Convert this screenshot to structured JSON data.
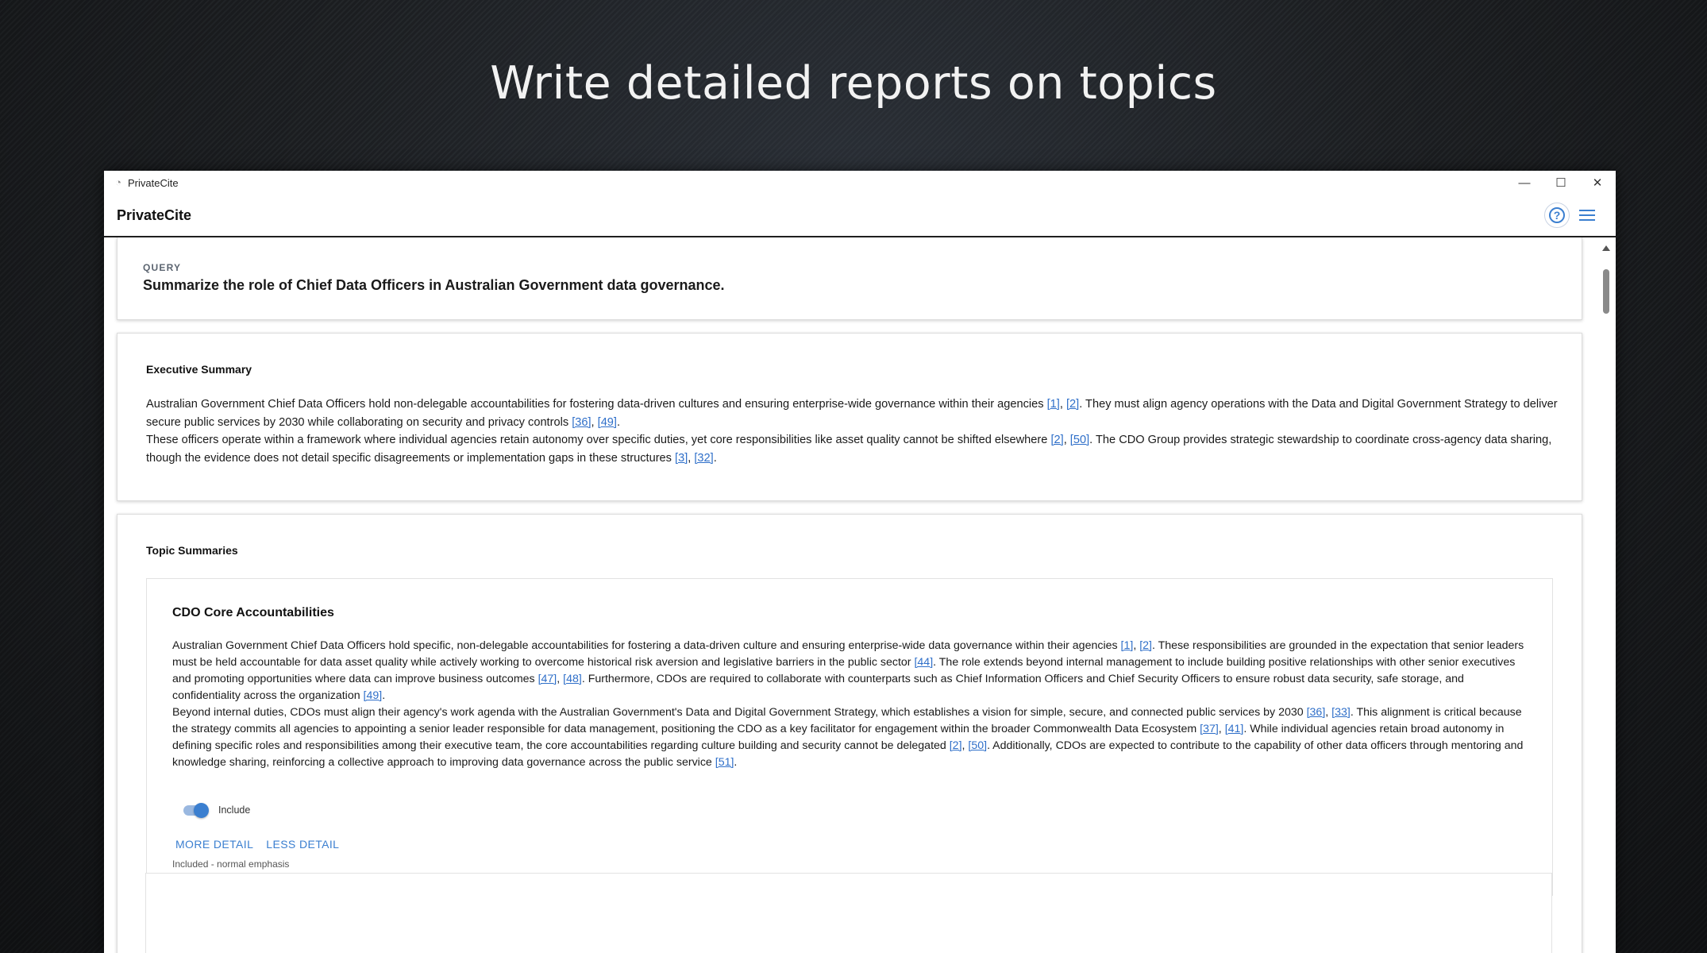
{
  "banner": {
    "title": "Write detailed reports on topics"
  },
  "window": {
    "title": "PrivateCite",
    "controls": {
      "minimize": "—",
      "maximize": "☐",
      "close": "✕"
    }
  },
  "header": {
    "brand": "PrivateCite",
    "help_icon": "?"
  },
  "query": {
    "label": "QUERY",
    "text": "Summarize the role of Chief Data Officers in Australian Government data governance."
  },
  "executive_summary": {
    "heading": "Executive Summary",
    "p1": {
      "t1": "Australian Government Chief Data Officers hold non-delegable accountabilities for fostering data-driven cultures and ensuring enterprise-wide governance within their agencies ",
      "c1": "[1]",
      "s1": ", ",
      "c2": "[2]",
      "t2": ". They must align agency operations with the Data and Digital Government Strategy to deliver secure public services by 2030 while collaborating on security and privacy controls ",
      "c3": "[36]",
      "s2": ", ",
      "c4": "[49]",
      "t3": "."
    },
    "p2": {
      "t1": "These officers operate within a framework where individual agencies retain autonomy over specific duties, yet core responsibilities like asset quality cannot be shifted elsewhere ",
      "c1": "[2]",
      "s1": ", ",
      "c2": "[50]",
      "t2": ". The CDO Group provides strategic stewardship to coordinate cross-agency data sharing, though the evidence does not detail specific disagreements or implementation gaps in these structures ",
      "c3": "[3]",
      "s2": ", ",
      "c4": "[32]",
      "t3": "."
    }
  },
  "topic_summaries": {
    "heading": "Topic Summaries",
    "topics": [
      {
        "title": "CDO Core Accountabilities",
        "p1": {
          "t1": "Australian Government Chief Data Officers hold specific, non-delegable accountabilities for fostering a data-driven culture and ensuring enterprise-wide data governance within their agencies ",
          "c1": "[1]",
          "s1": ", ",
          "c2": "[2]",
          "t2": ". These responsibilities are grounded in the expectation that senior leaders must be held accountable for data asset quality while actively working to overcome historical risk aversion and legislative barriers in the public sector ",
          "c3": "[44]",
          "t3": ". The role extends beyond internal management to include building positive relationships with other senior executives and promoting opportunities where data can improve business outcomes ",
          "c4": "[47]",
          "s2": ", ",
          "c5": "[48]",
          "t4": ". Furthermore, CDOs are required to collaborate with counterparts such as Chief Information Officers and Chief Security Officers to ensure robust data security, safe storage, and confidentiality across the organization ",
          "c6": "[49]",
          "t5": "."
        },
        "p2": {
          "t1": "Beyond internal duties, CDOs must align their agency's work agenda with the Australian Government's Data and Digital Government Strategy, which establishes a vision for simple, secure, and connected public services by 2030 ",
          "c1": "[36]",
          "s1": ", ",
          "c2": "[33]",
          "t2": ". This alignment is critical because the strategy commits all agencies to appointing a senior leader responsible for data management, positioning the CDO as a key facilitator for engagement within the broader Commonwealth Data Ecosystem ",
          "c3": "[37]",
          "s2": ", ",
          "c4": "[41]",
          "t3": ". While individual agencies retain broad autonomy in defining specific roles and responsibilities among their executive team, the core accountabilities regarding culture building and security cannot be delegated ",
          "c5": "[2]",
          "s3": ", ",
          "c6": "[50]",
          "t4": ". Additionally, CDOs are expected to contribute to the capability of other data officers through mentoring and knowledge sharing, reinforcing a collective approach to improving data governance across the public service ",
          "c7": "[51]",
          "t5": "."
        },
        "toggle_label": "Include",
        "toggle_on": true,
        "more_detail": "MORE DETAIL",
        "less_detail": "LESS DETAIL",
        "emphasis": "Included - normal emphasis"
      }
    ]
  },
  "colors": {
    "accent": "#3b7fd0",
    "link": "#2f6fc9",
    "header_rule": "#1f1f1f"
  }
}
